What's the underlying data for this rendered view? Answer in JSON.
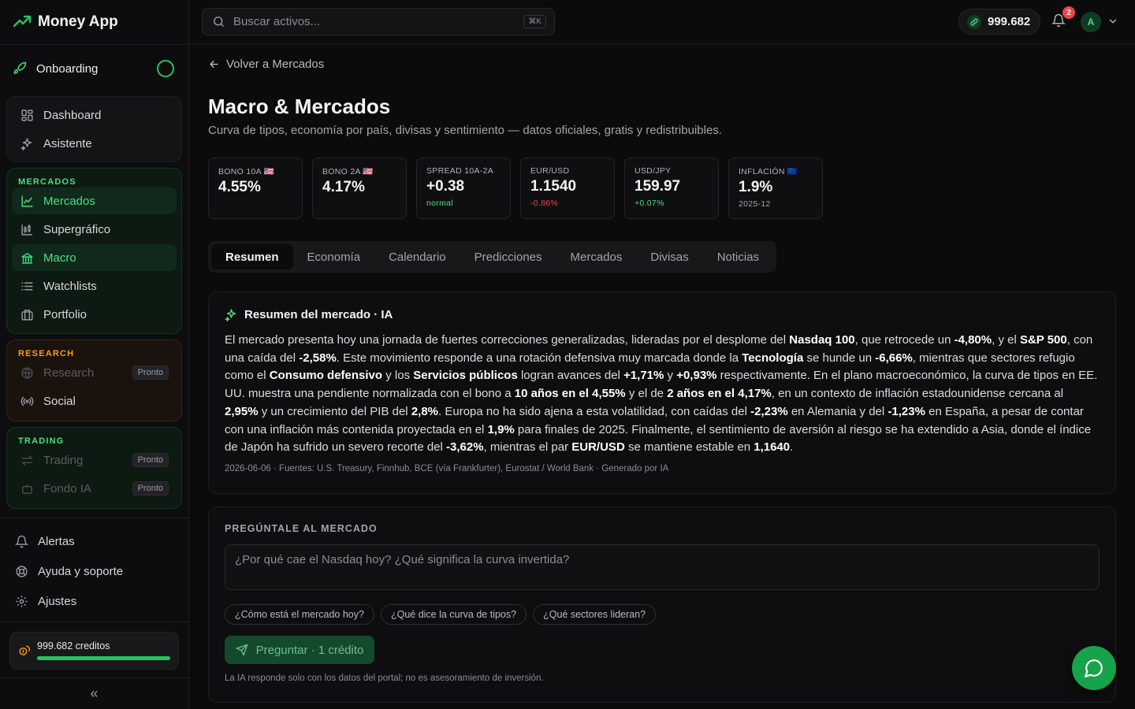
{
  "app": {
    "title": "Money App"
  },
  "sidebar": {
    "onboarding": "Onboarding",
    "general": [
      {
        "label": "Dashboard",
        "icon": "dashboard-icon"
      },
      {
        "label": "Asistente",
        "icon": "sparkles-icon"
      }
    ],
    "mercados": {
      "title": "MERCADOS",
      "items": [
        {
          "label": "Mercados",
          "icon": "line-chart-icon",
          "active": true
        },
        {
          "label": "Supergráfico",
          "icon": "candlestick-icon"
        },
        {
          "label": "Macro",
          "icon": "bank-icon",
          "active": true
        },
        {
          "label": "Watchlists",
          "icon": "list-icon"
        },
        {
          "label": "Portfolio",
          "icon": "briefcase-icon"
        }
      ]
    },
    "research": {
      "title": "RESEARCH",
      "items": [
        {
          "label": "Research",
          "icon": "globe-icon",
          "badge": "Pronto"
        },
        {
          "label": "Social",
          "icon": "radio-icon"
        }
      ]
    },
    "trading": {
      "title": "TRADING",
      "items": [
        {
          "label": "Trading",
          "icon": "swap-icon",
          "badge": "Pronto"
        },
        {
          "label": "Fondo IA",
          "icon": "bot-icon",
          "badge": "Pronto"
        }
      ]
    },
    "bottom": [
      {
        "label": "Alertas",
        "icon": "bell-icon"
      },
      {
        "label": "Ayuda y soporte",
        "icon": "lifebuoy-icon"
      },
      {
        "label": "Ajustes",
        "icon": "gear-icon"
      }
    ],
    "credits": {
      "label": "999.682 creditos",
      "progress": 1.0
    },
    "collapse": "«"
  },
  "topbar": {
    "search_placeholder": "Buscar activos...",
    "shortcut": "⌘K",
    "balance": "999.682",
    "notifications": "2",
    "avatar": "A"
  },
  "main": {
    "back": "Volver a Mercados",
    "title": "Macro & Mercados",
    "subtitle": "Curva de tipos, economía por país, divisas y sentimiento — datos oficiales, gratis y redistribuibles.",
    "stats": [
      {
        "label": "BONO 10A 🇺🇸",
        "value": "4.55%",
        "sub": "",
        "tone": "gray"
      },
      {
        "label": "BONO 2A 🇺🇸",
        "value": "4.17%",
        "sub": "",
        "tone": "gray"
      },
      {
        "label": "SPREAD 10A-2A",
        "value": "+0.38",
        "sub": "normal",
        "tone": "green"
      },
      {
        "label": "EUR/USD",
        "value": "1.1540",
        "sub": "-0.86%",
        "tone": "red"
      },
      {
        "label": "USD/JPY",
        "value": "159.97",
        "sub": "+0.07%",
        "tone": "green"
      },
      {
        "label": "INFLACIÓN 🇪🇺",
        "value": "1.9%",
        "sub": "2025-12",
        "tone": "gray"
      }
    ],
    "tabs": [
      "Resumen",
      "Economía",
      "Calendario",
      "Predicciones",
      "Mercados",
      "Divisas",
      "Noticias"
    ],
    "active_tab": "Resumen",
    "summary": {
      "title": "Resumen del mercado · IA",
      "segments": [
        {
          "t": "El mercado presenta hoy una jornada de fuertes correcciones generalizadas, lideradas por el desplome del "
        },
        {
          "t": "Nasdaq 100",
          "b": true
        },
        {
          "t": ", que retrocede un "
        },
        {
          "t": "-4,80%",
          "b": true
        },
        {
          "t": ", y el "
        },
        {
          "t": "S&P 500",
          "b": true
        },
        {
          "t": ", con una caída del "
        },
        {
          "t": "-2,58%",
          "b": true
        },
        {
          "t": ". Este movimiento responde a una rotación defensiva muy marcada donde la "
        },
        {
          "t": "Tecnología",
          "b": true
        },
        {
          "t": " se hunde un "
        },
        {
          "t": "-6,66%",
          "b": true
        },
        {
          "t": ", mientras que sectores refugio como el "
        },
        {
          "t": "Consumo defensivo",
          "b": true
        },
        {
          "t": " y los "
        },
        {
          "t": "Servicios públicos",
          "b": true
        },
        {
          "t": " logran avances del "
        },
        {
          "t": "+1,71%",
          "b": true
        },
        {
          "t": " y "
        },
        {
          "t": "+0,93%",
          "b": true
        },
        {
          "t": " respectivamente. En el plano macroeconómico, la curva de tipos en EE. UU. muestra una pendiente normalizada con el bono a "
        },
        {
          "t": "10 años en el 4,55%",
          "b": true
        },
        {
          "t": " y el de "
        },
        {
          "t": "2 años en el 4,17%",
          "b": true
        },
        {
          "t": ", en un contexto de inflación estadounidense cercana al "
        },
        {
          "t": "2,95%",
          "b": true
        },
        {
          "t": " y un crecimiento del PIB del "
        },
        {
          "t": "2,8%",
          "b": true
        },
        {
          "t": ". Europa no ha sido ajena a esta volatilidad, con caídas del "
        },
        {
          "t": "-2,23%",
          "b": true
        },
        {
          "t": " en Alemania y del "
        },
        {
          "t": "-1,23%",
          "b": true
        },
        {
          "t": " en España, a pesar de contar con una inflación más contenida proyectada en el "
        },
        {
          "t": "1,9%",
          "b": true
        },
        {
          "t": " para finales de 2025. Finalmente, el sentimiento de aversión al riesgo se ha extendido a Asia, donde el índice de Japón ha sufrido un severo recorte del "
        },
        {
          "t": "-3,62%",
          "b": true
        },
        {
          "t": ", mientras el par "
        },
        {
          "t": "EUR/USD",
          "b": true
        },
        {
          "t": " se mantiene estable en "
        },
        {
          "t": "1,1640",
          "b": true
        },
        {
          "t": "."
        }
      ],
      "meta": "2026-06-06 · Fuentes: U.S. Treasury, Finnhub, BCE (vía Frankfurter), Eurostat / World Bank · Generado por IA"
    },
    "ask": {
      "title": "PREGÚNTALE AL MERCADO",
      "placeholder": "¿Por qué cae el Nasdaq hoy? ¿Qué significa la curva invertida?",
      "chips": [
        "¿Cómo está el mercado hoy?",
        "¿Qué dice la curva de tipos?",
        "¿Qué sectores lideran?"
      ],
      "button": "Preguntar · 1 crédito",
      "note": "La IA responde solo con los datos del portal; no es asesoramiento de inversión."
    }
  },
  "colors": {
    "accent": "#22c55e",
    "negative": "#ef4444",
    "research": "#f59e0b"
  }
}
